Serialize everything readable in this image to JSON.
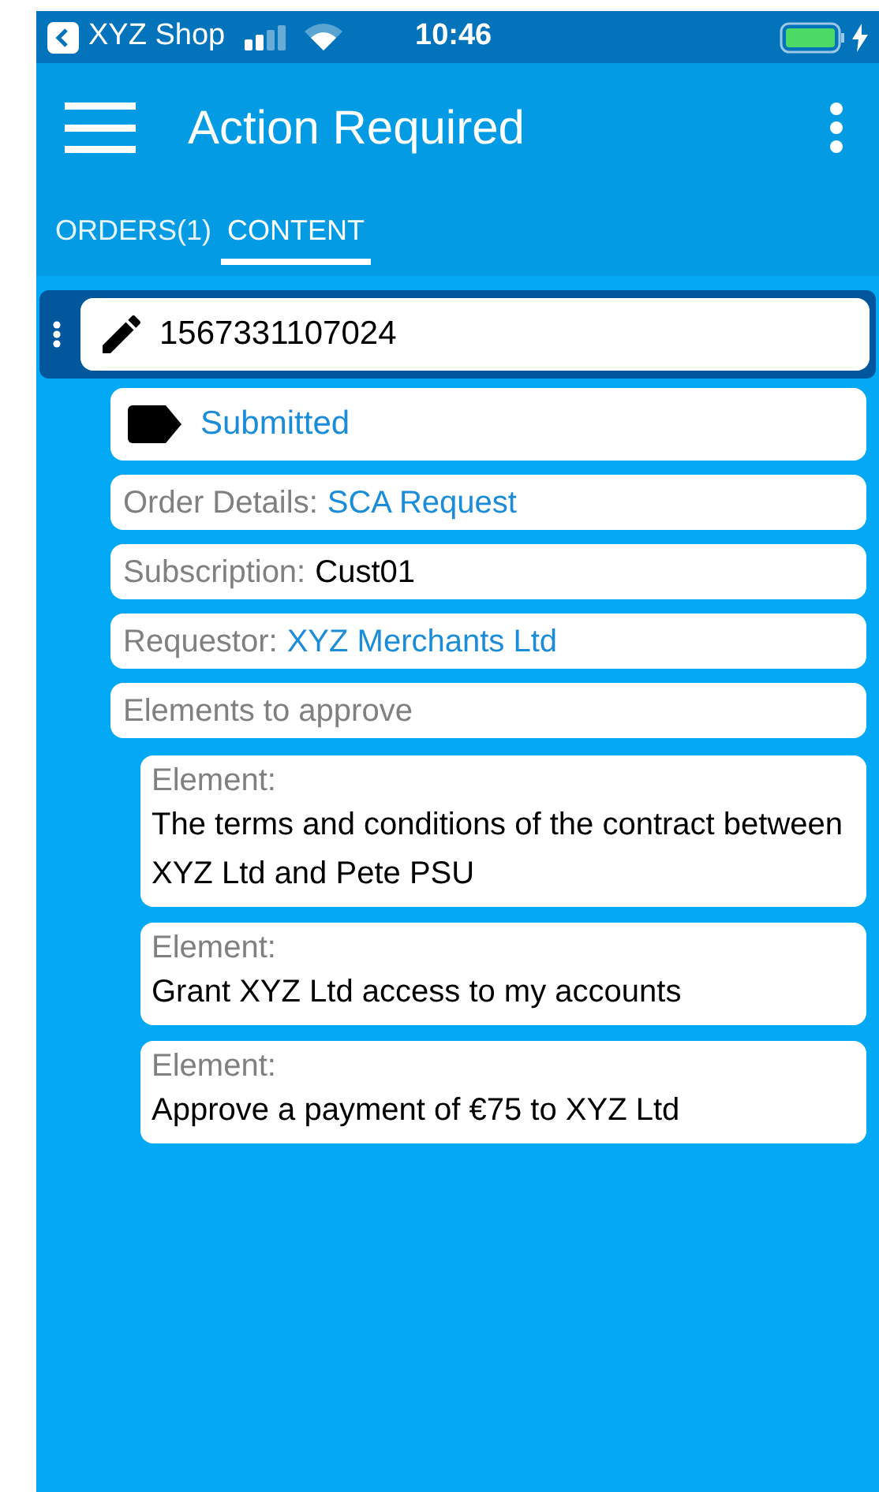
{
  "status_bar": {
    "back_app": "XYZ Shop",
    "time": "10:46"
  },
  "app_bar": {
    "title": "Action Required"
  },
  "tabs": [
    {
      "label": "ORDERS(1)",
      "selected": false
    },
    {
      "label": "CONTENT",
      "selected": true
    }
  ],
  "order": {
    "number": "1567331107024",
    "selected": true,
    "status": "Submitted",
    "fields": [
      {
        "label": "Order Details:",
        "value": "SCA Request",
        "kind": "link"
      },
      {
        "label": "Subscription:",
        "value": "Cust01",
        "kind": "plain"
      },
      {
        "label": "Requestor:",
        "value": "XYZ Merchants Ltd",
        "kind": "link"
      },
      {
        "label": "Elements to approve",
        "kind": "header"
      }
    ],
    "elements": [
      {
        "label": "Element:",
        "text": "The terms and conditions of the contract between XYZ Ltd and Pete PSU"
      },
      {
        "label": "Element:",
        "text": "Grant XYZ Ltd access to my accounts"
      },
      {
        "label": "Element:",
        "text": "Approve a payment of €75 to XYZ Ltd"
      }
    ]
  }
}
